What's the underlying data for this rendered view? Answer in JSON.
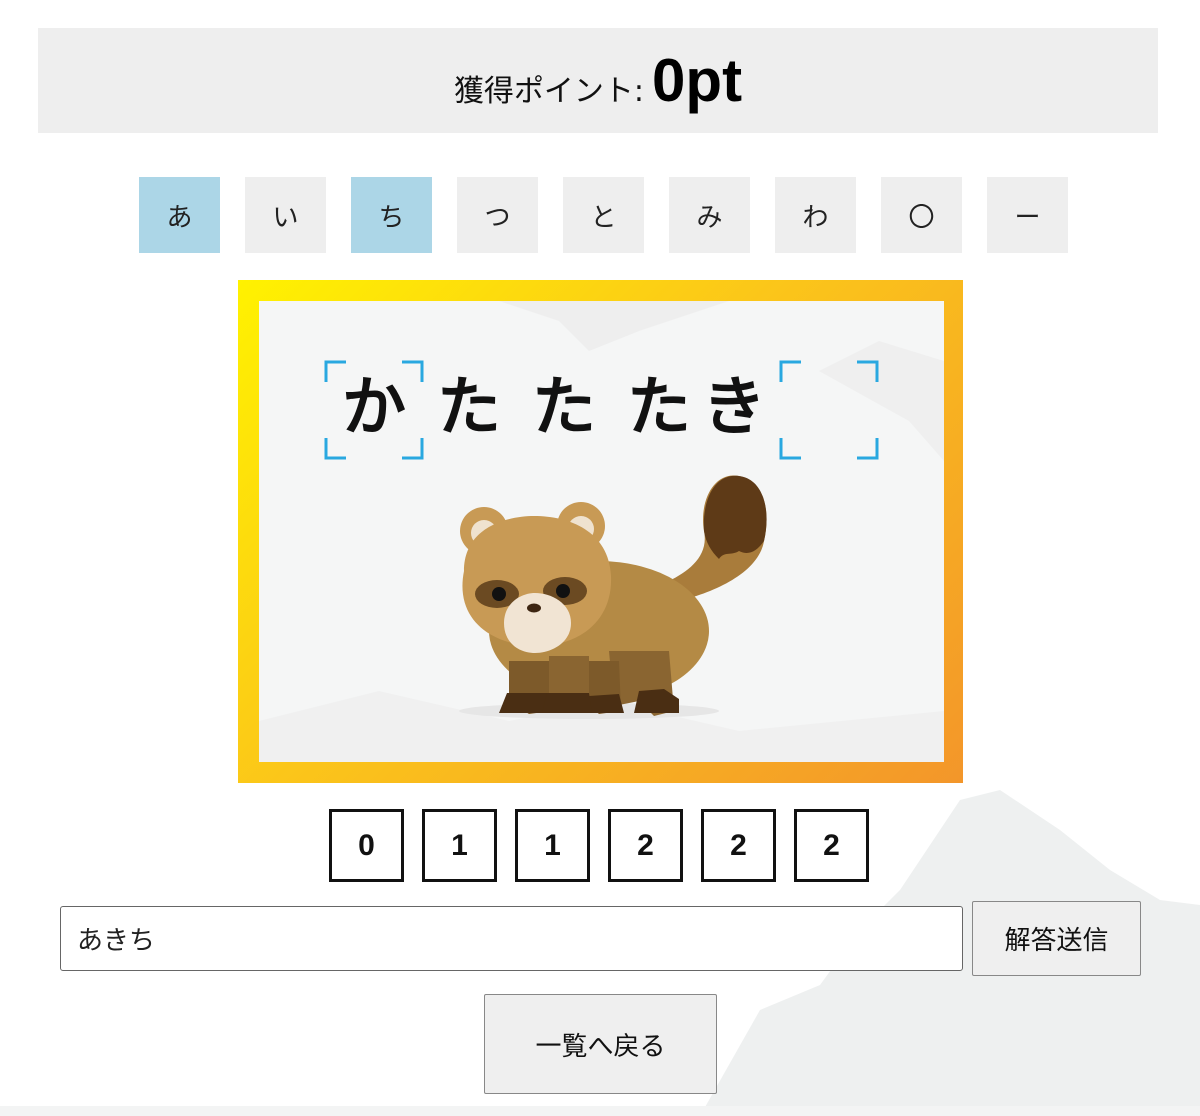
{
  "score": {
    "label": "獲得ポイント:",
    "value": "0pt"
  },
  "kana_keys": [
    {
      "label": "あ",
      "selected": true
    },
    {
      "label": "い",
      "selected": false
    },
    {
      "label": "ち",
      "selected": true
    },
    {
      "label": "つ",
      "selected": false
    },
    {
      "label": "と",
      "selected": false
    },
    {
      "label": "み",
      "selected": false
    },
    {
      "label": "わ",
      "selected": false
    },
    {
      "label": "〇",
      "selected": false
    },
    {
      "label": "ー",
      "selected": false
    }
  ],
  "card": {
    "word_chars": [
      "か",
      "た",
      "た",
      "た",
      "き"
    ],
    "image": "raccoon-dog-illustration",
    "colors": {
      "frame_start": "#fff200",
      "frame_end": "#f3962a",
      "bracket": "#29a8e0",
      "selected_key": "#acd6e7"
    }
  },
  "digits": [
    "0",
    "1",
    "1",
    "2",
    "2",
    "2"
  ],
  "answer": {
    "value": "あきち",
    "submit_label": "解答送信"
  },
  "back_label": "一覧へ戻る"
}
